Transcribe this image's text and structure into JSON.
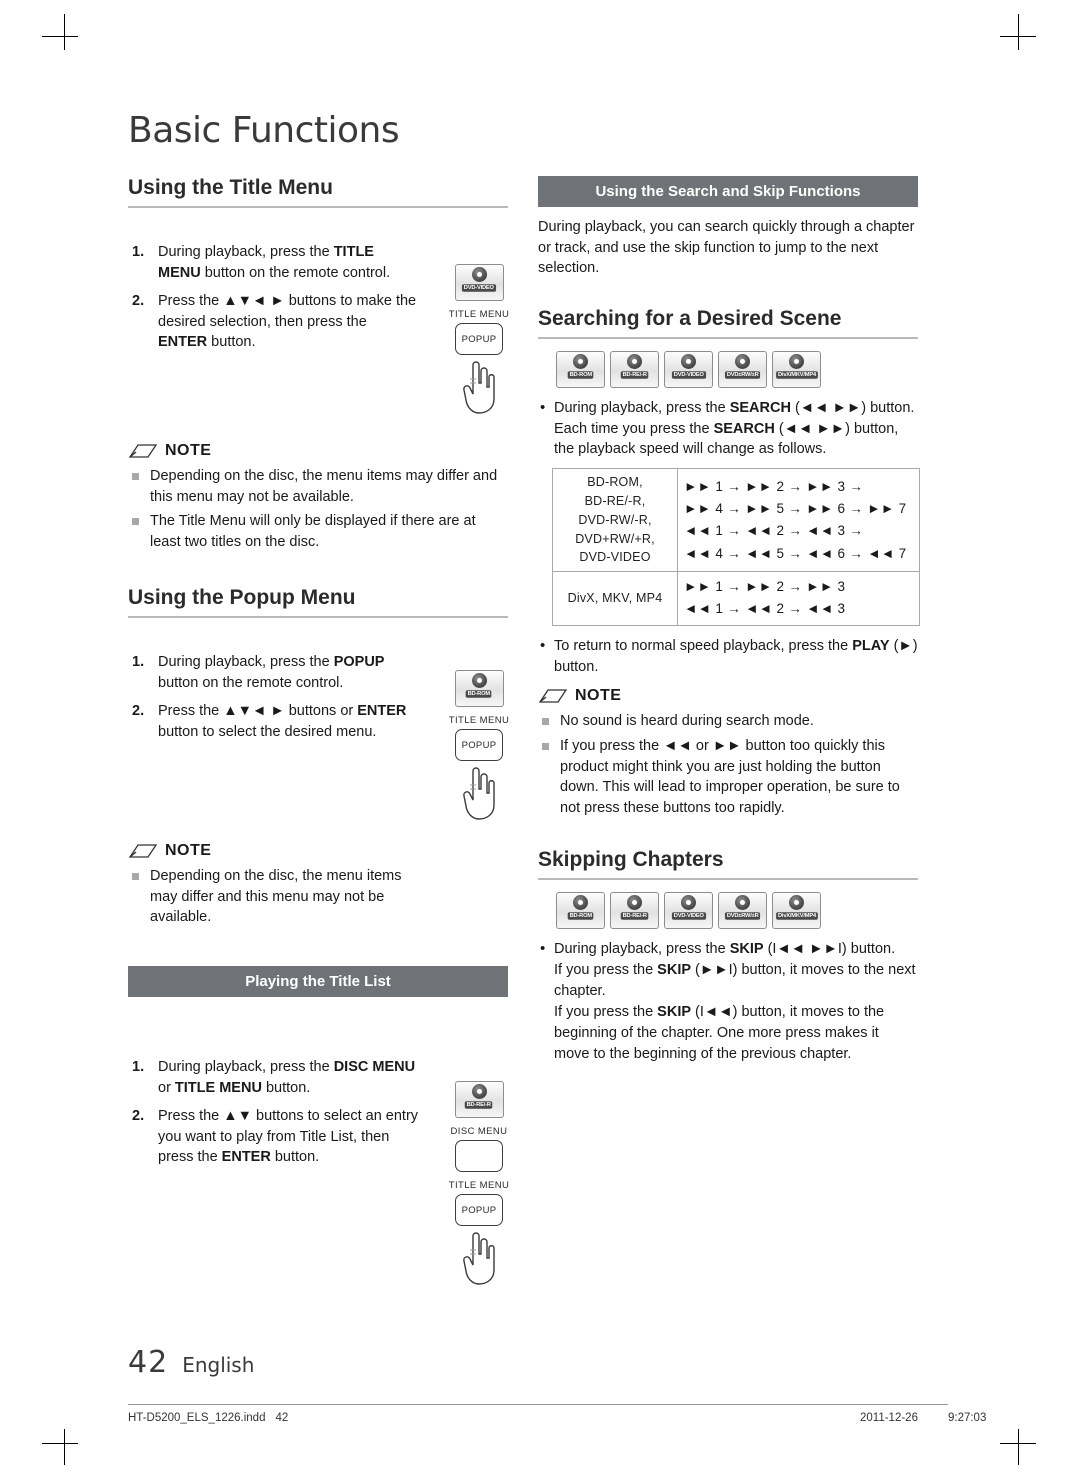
{
  "page": {
    "chapter_title": "Basic Functions",
    "page_number": "42",
    "language": "English",
    "footer_file": "HT-D5200_ELS_1226.indd",
    "footer_file_page": "42",
    "footer_date": "2011-12-26",
    "footer_time": "9:27:03"
  },
  "left_column": {
    "title_menu": {
      "heading": "Using the Title Menu",
      "steps": [
        {
          "num": "1.",
          "text_parts": [
            "During playback, press the ",
            "TITLE MENU",
            " button on the remote control."
          ]
        },
        {
          "num": "2.",
          "text_parts": [
            "Press the ",
            "▲▼◄ ►",
            " buttons to make the desired selection, then press the ",
            "ENTER",
            " button."
          ]
        }
      ],
      "step1_html": "During playback, press the <b>TITLE MENU</b> button on the remote control.",
      "step2_html": "Press the <b>▲▼◄ ►</b> buttons to make the desired selection, then press the <b>ENTER</b> button.",
      "note_label": "NOTE",
      "notes": [
        "Depending on the disc, the menu items may differ and this menu may not be available.",
        "The Title Menu will only be displayed if there are at least two titles on the disc."
      ],
      "disc_badge": "DVD-VIDEO",
      "remote_labels": {
        "title_menu": "TITLE MENU",
        "popup": "POPUP"
      }
    },
    "popup_menu": {
      "heading": "Using the Popup Menu",
      "step1_html": "During playback, press the <b>POPUP</b> button on the remote control.",
      "step2_html": "Press the <b>▲▼◄ ►</b> buttons or <b>ENTER</b> button to select the desired menu.",
      "note_label": "NOTE",
      "notes": [
        "Depending on the disc, the menu items may differ and this menu may not be available."
      ],
      "disc_badge": "BD-ROM",
      "remote_labels": {
        "title_menu": "TITLE MENU",
        "popup": "POPUP"
      }
    },
    "title_list": {
      "heading": "Playing the Title List",
      "step1_html": "During playback, press the <b>DISC MENU</b> or <b>TITLE MENU</b> button.",
      "step2_html": "Press the <b>▲▼</b> buttons to select an entry you want to play from Title List, then press the <b>ENTER</b> button.",
      "disc_badge": "BD-RE/-R",
      "remote_labels": {
        "disc_menu": "DISC MENU",
        "title_menu": "TITLE MENU",
        "popup": "POPUP"
      }
    }
  },
  "right_column": {
    "search_skip": {
      "heading": "Using the Search and Skip Functions",
      "body": "During playback, you can search quickly through a chapter or track, and use the skip function to jump to the next selection."
    },
    "searching_scene": {
      "heading": "Searching for a Desired Scene",
      "discs": [
        "BD-ROM",
        "BD-RE/-R",
        "DVD-VIDEO",
        "DVD±RW/±R",
        "DivX/MKV/MP4"
      ],
      "bullet1_html": "During playback, press the <b>SEARCH</b> (◄◄ ►►) button.<br>Each time you press the <b>SEARCH</b> (◄◄ ►►) button, the playback speed will change as follows.",
      "table": {
        "rows": [
          {
            "discs": [
              "BD-ROM,",
              "BD-RE/-R,",
              "DVD-RW/-R,",
              "DVD+RW/+R,",
              "DVD-VIDEO"
            ],
            "sequences": [
              "►► 1 → ►► 2 → ►► 3 →",
              "►► 4 → ►► 5 → ►► 6 → ►► 7",
              "◄◄ 1 → ◄◄ 2 → ◄◄ 3 →",
              "◄◄ 4 → ◄◄ 5 → ◄◄ 6 → ◄◄ 7"
            ]
          },
          {
            "discs": [
              "DivX, MKV, MP4"
            ],
            "sequences": [
              "►► 1 → ►► 2 → ►► 3",
              "◄◄ 1 → ◄◄ 2 → ◄◄ 3"
            ]
          }
        ]
      },
      "bullet2_html": "To return to normal speed playback, press the <b>PLAY</b> (►) button.",
      "note_label": "NOTE",
      "notes": [
        "No sound is heard during search mode.",
        "If you press the ◄◄ or ►► button too quickly this product might think you are just holding the button down.  This will lead to improper operation, be sure to not press these buttons too rapidly."
      ]
    },
    "skipping_chapters": {
      "heading": "Skipping Chapters",
      "discs": [
        "BD-ROM",
        "BD-RE/-R",
        "DVD-VIDEO",
        "DVD±RW/±R",
        "DivX/MKV/MP4"
      ],
      "bullet_html": "During playback, press the <b>SKIP</b> (I◄◄ ►►I) button.<br>If you press the <b>SKIP</b> (►►I) button, it moves to the next chapter.<br>If you press the <b>SKIP</b> (I◄◄) button, it moves to the beginning of the chapter. One more press makes it move to the beginning of the previous chapter."
    }
  }
}
